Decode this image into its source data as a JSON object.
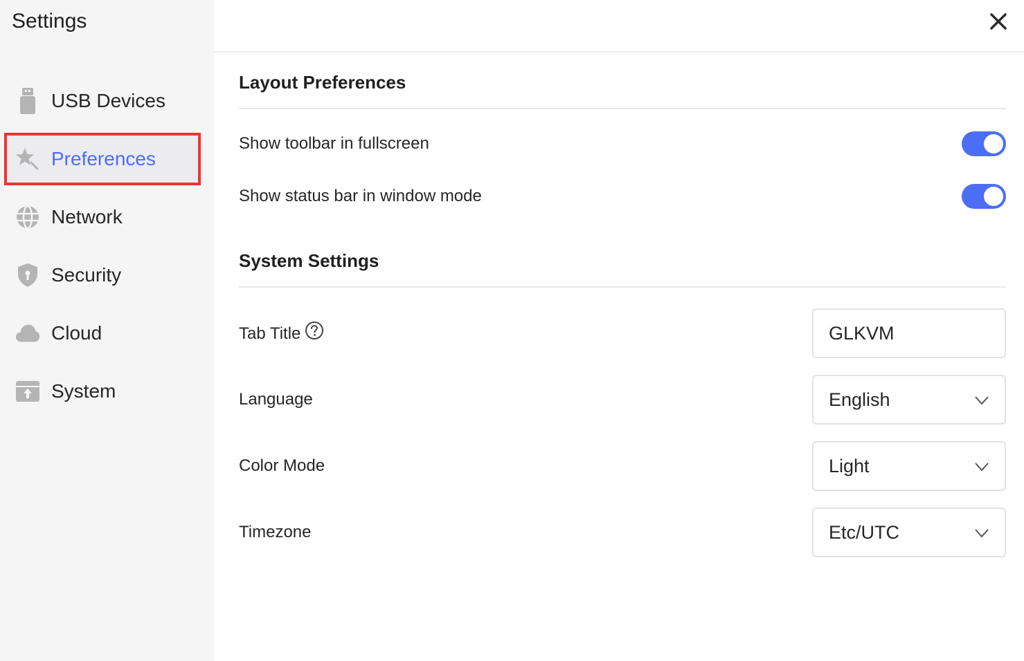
{
  "sidebar": {
    "title": "Settings",
    "items": [
      {
        "label": "USB Devices",
        "icon": "usb-drive-icon"
      },
      {
        "label": "Preferences",
        "icon": "star-wand-icon",
        "active": true
      },
      {
        "label": "Network",
        "icon": "globe-icon"
      },
      {
        "label": "Security",
        "icon": "shield-icon"
      },
      {
        "label": "Cloud",
        "icon": "cloud-icon"
      },
      {
        "label": "System",
        "icon": "upload-box-icon"
      }
    ]
  },
  "header": {
    "close_icon": "close-icon"
  },
  "layout": {
    "title": "Layout Preferences",
    "toolbar_label": "Show toolbar in fullscreen",
    "toolbar_on": true,
    "statusbar_label": "Show status bar in window mode",
    "statusbar_on": true
  },
  "system": {
    "title": "System Settings",
    "tab_title_label": "Tab Title",
    "tab_title_value": "GLKVM",
    "language_label": "Language",
    "language_value": "English",
    "color_mode_label": "Color Mode",
    "color_mode_value": "Light",
    "timezone_label": "Timezone",
    "timezone_value": "Etc/UTC"
  },
  "colors": {
    "accent": "#4c6ef5",
    "highlight_outline": "#ee3434",
    "icon_gray": "#b4b4b4"
  }
}
